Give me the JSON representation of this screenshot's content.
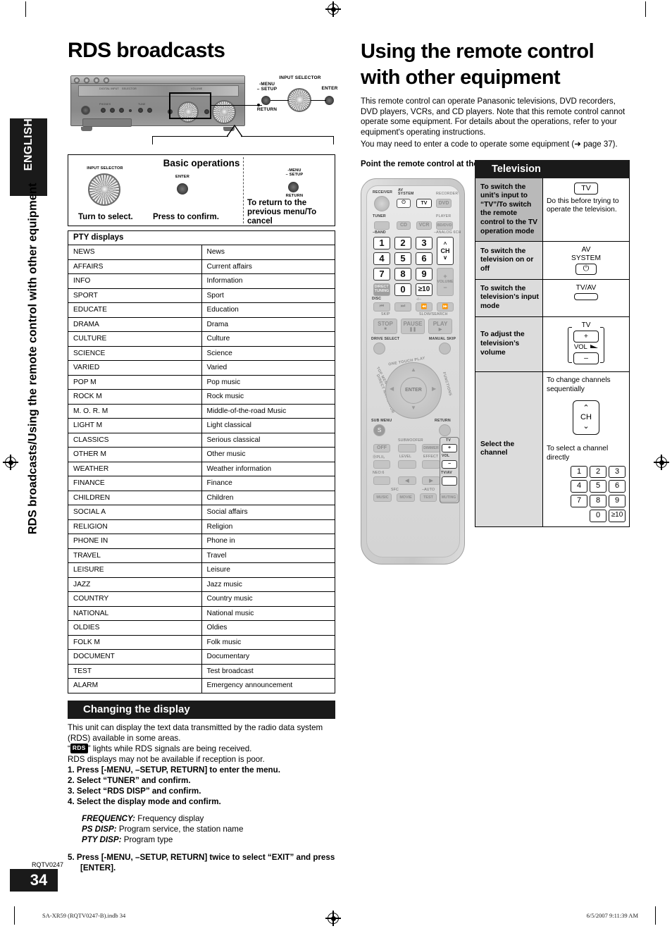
{
  "page": {
    "sidebar_language": "ENGLISH",
    "sidebar_title": "RDS broadcasts/Using the remote control with other equipment",
    "rqt_code": "RQTV0247",
    "page_number": "34",
    "footer_left": "SA-XR59 (RQTV0247-B).indb   34",
    "footer_right": "6/5/2007   9:11:39 AM"
  },
  "left": {
    "title": "RDS broadcasts",
    "receiver_labels": {
      "input_selector": "INPUT SELECTOR",
      "menu_setup": "-MENU\n– SETUP",
      "return": "RETURN",
      "enter": "ENTER"
    },
    "basic": {
      "title": "Basic operations",
      "input_selector": "INPUT SELECTOR",
      "enter": "ENTER",
      "menu_setup": "-MENU\n– SETUP",
      "return": "RETURN",
      "turn_caption": "Turn to select.",
      "press_caption": "Press to confirm.",
      "cancel_caption": "To return to the previous menu/To cancel"
    },
    "pty": {
      "header": "PTY displays",
      "rows": [
        [
          "NEWS",
          "News"
        ],
        [
          "AFFAIRS",
          "Current affairs"
        ],
        [
          "INFO",
          "Information"
        ],
        [
          "SPORT",
          "Sport"
        ],
        [
          "EDUCATE",
          "Education"
        ],
        [
          "DRAMA",
          "Drama"
        ],
        [
          "CULTURE",
          "Culture"
        ],
        [
          "SCIENCE",
          "Science"
        ],
        [
          "VARIED",
          "Varied"
        ],
        [
          "POP M",
          "Pop music"
        ],
        [
          "ROCK M",
          "Rock music"
        ],
        [
          "M. O. R.  M",
          "Middle-of-the-road Music"
        ],
        [
          "LIGHT M",
          "Light classical"
        ],
        [
          "CLASSICS",
          "Serious classical"
        ],
        [
          "OTHER M",
          "Other music"
        ],
        [
          "WEATHER",
          "Weather information"
        ],
        [
          "FINANCE",
          "Finance"
        ],
        [
          "CHILDREN",
          "Children"
        ],
        [
          "SOCIAL A",
          "Social affairs"
        ],
        [
          "RELIGION",
          "Religion"
        ],
        [
          "PHONE IN",
          "Phone in"
        ],
        [
          "TRAVEL",
          "Travel"
        ],
        [
          "LEISURE",
          "Leisure"
        ],
        [
          "JAZZ",
          "Jazz music"
        ],
        [
          "COUNTRY",
          "Country music"
        ],
        [
          "NATIONAL",
          "National music"
        ],
        [
          "OLDIES",
          "Oldies"
        ],
        [
          "FOLK M",
          "Folk music"
        ],
        [
          "DOCUMENT",
          "Documentary"
        ],
        [
          "TEST",
          "Test broadcast"
        ],
        [
          "ALARM",
          "Emergency announcement"
        ]
      ]
    },
    "changing": {
      "bar_title": "Changing the display",
      "para1": "This unit can display the text data transmitted by the radio data system (RDS) available in some areas.",
      "badge": "RDS",
      "para2_before": "“",
      "para2_after": "” lights while RDS signals are being received.",
      "para3": "RDS displays may not be available if reception is poor.",
      "steps": [
        "1.  Press [-MENU, –SETUP, RETURN] to enter the menu.",
        "2.  Select “TUNER” and confirm.",
        "3.  Select “RDS DISP” and confirm.",
        "4.  Select the display mode and confirm."
      ],
      "modes": [
        {
          "name": "FREQUENCY:",
          "desc": " Frequency display"
        },
        {
          "name": "PS DISP:",
          "desc": " Program service, the station name"
        },
        {
          "name": "PTY DISP:",
          "desc": " Program type"
        }
      ],
      "step5": "5.  Press [-MENU, –SETUP, RETURN] twice to select “EXIT” and press [ENTER]."
    }
  },
  "right": {
    "title": "Using the remote control with other equipment",
    "intro": "This remote control can operate Panasonic televisions, DVD recorders, DVD players, VCRs, and CD players. Note that this remote control cannot operate some equipment. For details about the operations, refer to your equipment's operating instructions.",
    "intro2": "You may need to enter a code to operate some equipment (➜ page 37).",
    "point_note": "Point the remote control at the equipment you want to operate.",
    "remote": {
      "receiver": "RECEIVER",
      "av_system": "AV\nSYSTEM",
      "tv": "TV",
      "recorder": "RECORDER",
      "dvd": "DVD",
      "tuner": "TUNER",
      "band": "–BAND",
      "cd": "CD",
      "vcr": "VCR",
      "player": "PLAYER",
      "bd_dvd": "BD/DVD",
      "analog6ch": "–ANALOG 6CH",
      "numbers": [
        "1",
        "2",
        "3",
        "4",
        "5",
        "6",
        "7",
        "8",
        "9",
        "0"
      ],
      "ten_key": "≥10",
      "ten_sub": "-/--",
      "ch": "CH",
      "volume": "VOLUME",
      "direct_tuning": "DIRECT\nTUNING",
      "disc": "DISC",
      "skip": "SKIP",
      "slow_search": "SLOW/SEARCH",
      "stop": "STOP",
      "pause": "PAUSE",
      "play": "PLAY",
      "drive_select": "DRIVE SELECT",
      "manual_skip": "MANUAL SKIP",
      "one_touch_play": "ONE TOUCH PLAY",
      "top_menu": "TOP MENU",
      "direct_navigator": "DIRECT NAVIGATOR",
      "functions": "FUNCTIONS",
      "enter": "ENTER",
      "sub_menu": "SUB MENU",
      "sub_menu_key": "S",
      "return": "RETURN",
      "subwoofer": "SUBWOOFER",
      "off": "OFF",
      "dimmer": "DIMMER",
      "dolby_plii": "ⒹPLIIₓ",
      "level": "LEVEL",
      "effect": "EFFECT",
      "neo6": "NEO:6",
      "sfc": "SFC",
      "music": "MUSIC",
      "movie": "MOVIE",
      "auto": "–AUTO",
      "test": "TEST",
      "muting": "MUTING",
      "tv_group": "TV",
      "vol": "VOL",
      "plus": "+",
      "minus": "–",
      "tv_av": "TV/AV"
    },
    "tv_table": {
      "header": "Television",
      "rows": [
        {
          "action": "To switch the unit’s input to “TV”/To switch the remote control to the TV operation mode",
          "key": "TV",
          "note": "Do this before trying to operate the television."
        },
        {
          "action": "To switch the television on or off",
          "key_label": "AV\nSYSTEM",
          "key_glyph": "⏻"
        },
        {
          "action": "To switch the television’s input mode",
          "key_label": "TV/AV"
        },
        {
          "action": "To adjust the television’s volume",
          "key_label": "TV",
          "vol_label": "VOL",
          "plus": "+",
          "minus": "–"
        },
        {
          "action": "Select the channel",
          "note_seq": "To change channels sequentially",
          "ch": "CH",
          "note_direct": "To select a channel directly",
          "numbers": [
            "1",
            "2",
            "3",
            "4",
            "5",
            "6",
            "7",
            "8",
            "9"
          ],
          "zero": "0",
          "ten": "≥10"
        }
      ]
    }
  }
}
